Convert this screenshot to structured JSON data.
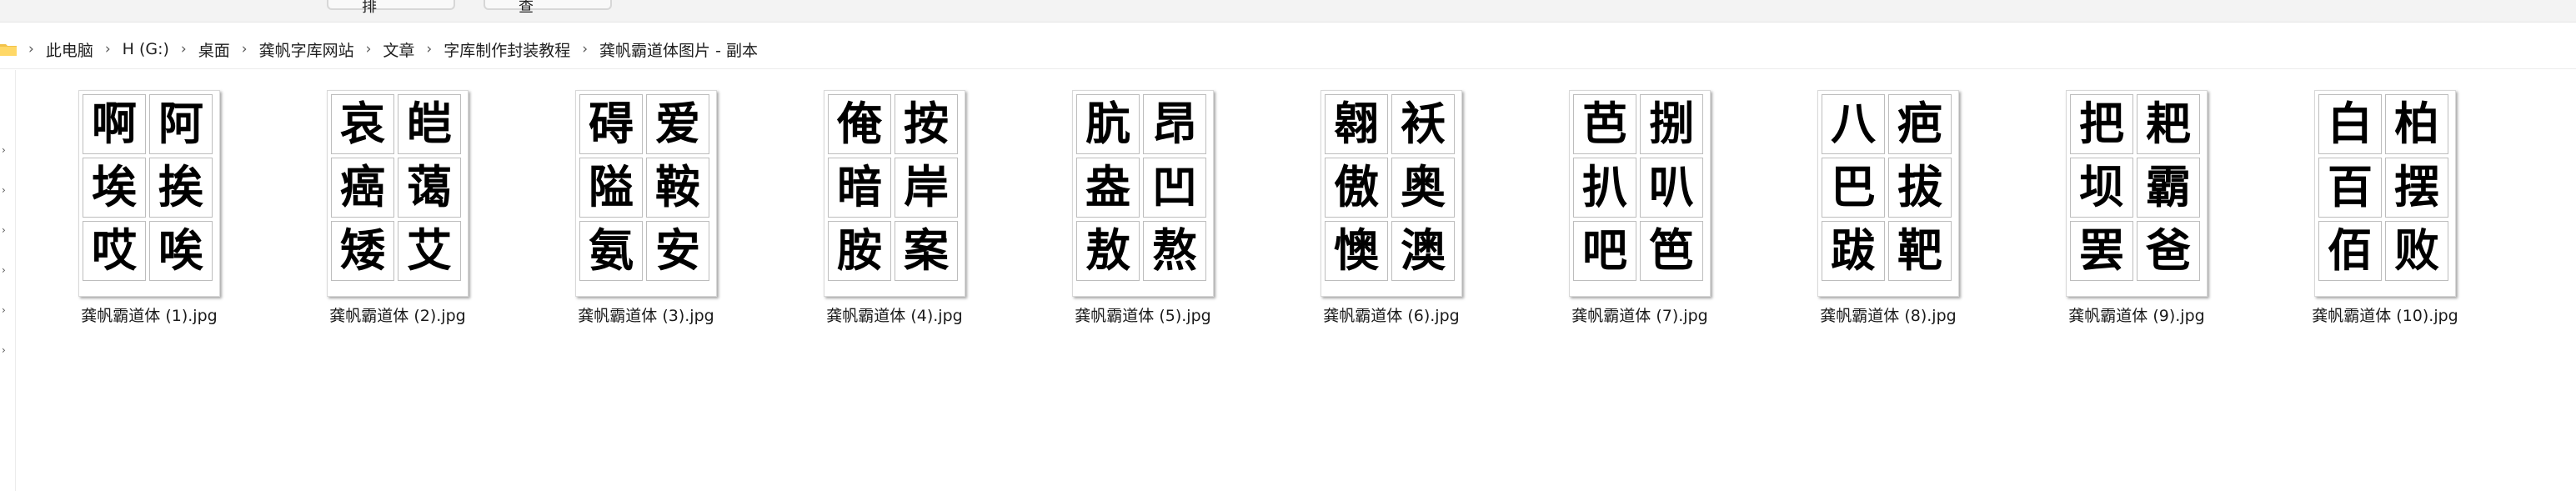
{
  "toolbar": {
    "tab_a_label": "排",
    "tab_b_label": "查"
  },
  "breadcrumb": {
    "items": [
      "此电脑",
      "H (G:)",
      "桌面",
      "龚帆字库网站",
      "文章",
      "字库制作封装教程",
      "龚帆霸道体图片 - 副本"
    ],
    "separator": "›"
  },
  "files": [
    {
      "name": "龚帆霸道体 (1).jpg",
      "chars": [
        "啊",
        "阿",
        "埃",
        "挨",
        "哎",
        "唉"
      ]
    },
    {
      "name": "龚帆霸道体 (2).jpg",
      "chars": [
        "哀",
        "皑",
        "癌",
        "蔼",
        "矮",
        "艾"
      ]
    },
    {
      "name": "龚帆霸道体 (3).jpg",
      "chars": [
        "碍",
        "爱",
        "隘",
        "鞍",
        "氨",
        "安"
      ]
    },
    {
      "name": "龚帆霸道体 (4).jpg",
      "chars": [
        "俺",
        "按",
        "暗",
        "岸",
        "胺",
        "案"
      ]
    },
    {
      "name": "龚帆霸道体 (5).jpg",
      "chars": [
        "肮",
        "昂",
        "盎",
        "凹",
        "敖",
        "熬"
      ]
    },
    {
      "name": "龚帆霸道体 (6).jpg",
      "chars": [
        "翱",
        "袄",
        "傲",
        "奥",
        "懊",
        "澳"
      ]
    },
    {
      "name": "龚帆霸道体 (7).jpg",
      "chars": [
        "芭",
        "捌",
        "扒",
        "叭",
        "吧",
        "笆"
      ]
    },
    {
      "name": "龚帆霸道体 (8).jpg",
      "chars": [
        "八",
        "疤",
        "巴",
        "拔",
        "跋",
        "靶"
      ]
    },
    {
      "name": "龚帆霸道体 (9).jpg",
      "chars": [
        "把",
        "耙",
        "坝",
        "霸",
        "罢",
        "爸"
      ]
    },
    {
      "name": "龚帆霸道体 (10).jpg",
      "chars": [
        "白",
        "柏",
        "百",
        "摆",
        "佰",
        "败"
      ]
    }
  ]
}
